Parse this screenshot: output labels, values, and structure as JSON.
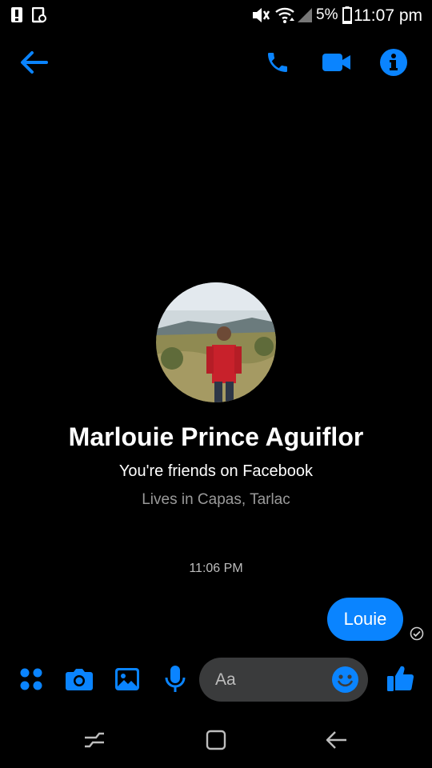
{
  "status_bar": {
    "battery": "5%",
    "time": "11:07 pm"
  },
  "header": {
    "back_icon": "arrow-left-icon",
    "actions": [
      "phone-icon",
      "video-camera-icon",
      "info-icon"
    ]
  },
  "profile": {
    "name": "Marlouie Prince Aguiflor",
    "relationship": "You're friends on Facebook",
    "location": "Lives in Capas, Tarlac"
  },
  "conversation": {
    "timestamp": "11:06 PM",
    "messages": [
      {
        "text": "Louie",
        "from": "me",
        "status": "sent"
      }
    ]
  },
  "composer": {
    "placeholder": "Aa",
    "tools": [
      "apps-icon",
      "camera-icon",
      "gallery-icon",
      "microphone-icon"
    ],
    "emoji_icon": "emoji-icon",
    "like_icon": "thumbs-up-icon"
  },
  "nav_bar": [
    "recent-apps-icon",
    "home-icon",
    "back-icon"
  ],
  "colors": {
    "accent": "#0a84ff",
    "background": "#000000",
    "composer_bg": "#3a3b3c"
  }
}
